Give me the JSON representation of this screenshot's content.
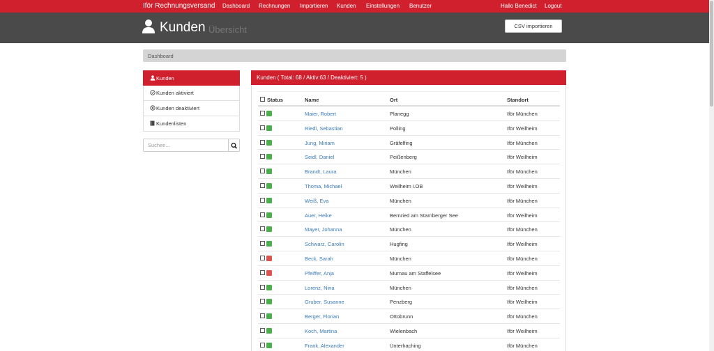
{
  "navbar": {
    "brand": "Iför Rechnungsversand",
    "items": [
      "Dashboard",
      "Rechnungen",
      "Importieren",
      "Kunden",
      "Einstellungen",
      "Benutzer"
    ],
    "greeting": "Hallo Benedict",
    "logout": "Logout"
  },
  "header": {
    "title": "Kunden",
    "subtitle": "Übersicht",
    "csv_button": "CSV importieren"
  },
  "breadcrumb": {
    "item": "Dashboard"
  },
  "sidebar": {
    "items": [
      {
        "label": "Kunden",
        "icon": "user-icon"
      },
      {
        "label": "Kunden aktiviert",
        "icon": "check-circle-icon"
      },
      {
        "label": "Kunden deaktiviert",
        "icon": "x-circle-icon"
      },
      {
        "label": "Kundenlisten",
        "icon": "book-icon"
      }
    ],
    "search_placeholder": "Suchen..."
  },
  "panel": {
    "heading": "Kunden ( Total: 68 / Aktiv:63 / Deaktiviert: 5 )",
    "columns": {
      "status": "Status",
      "name": "Name",
      "ort": "Ort",
      "standort": "Standort"
    },
    "rows": [
      {
        "status": "active",
        "name": "Maier, Robert",
        "ort": "Planegg",
        "standort": "Iför München"
      },
      {
        "status": "active",
        "name": "Riedl, Sebastian",
        "ort": "Polling",
        "standort": "Iför Weilheim"
      },
      {
        "status": "active",
        "name": "Jung, Miriam",
        "ort": "Gräfelfing",
        "standort": "Iför München"
      },
      {
        "status": "active",
        "name": "Seidl, Daniel",
        "ort": "Peißenberg",
        "standort": "Iför Weilheim"
      },
      {
        "status": "active",
        "name": "Brandt, Laura",
        "ort": "München",
        "standort": "Iför München"
      },
      {
        "status": "active",
        "name": "Thoma, Michael",
        "ort": "Weilheim i.OB",
        "standort": "Iför Weilheim"
      },
      {
        "status": "active",
        "name": "Weiß, Eva",
        "ort": "München",
        "standort": "Iför München"
      },
      {
        "status": "active",
        "name": "Auer, Heike",
        "ort": "Bernried am Starnberger See",
        "standort": "Iför Weilheim"
      },
      {
        "status": "active",
        "name": "Mayer, Johanna",
        "ort": "München",
        "standort": "Iför München"
      },
      {
        "status": "active",
        "name": "Schwarz, Carolin",
        "ort": "Hugfing",
        "standort": "Iför Weilheim"
      },
      {
        "status": "inactive",
        "name": "Beck, Sarah",
        "ort": "München",
        "standort": "Iför München"
      },
      {
        "status": "inactive",
        "name": "Pfeiffer, Anja",
        "ort": "Murnau am Staffelsee",
        "standort": "Iför Weilheim"
      },
      {
        "status": "active",
        "name": "Lorenz, Nina",
        "ort": "München",
        "standort": "Iför München"
      },
      {
        "status": "active",
        "name": "Gruber, Susanne",
        "ort": "Penzberg",
        "standort": "Iför Weilheim"
      },
      {
        "status": "active",
        "name": "Berger, Florian",
        "ort": "Ottobrunn",
        "standort": "Iför München"
      },
      {
        "status": "active",
        "name": "Koch, Martina",
        "ort": "Wielenbach",
        "standort": "Iför Weilheim"
      },
      {
        "status": "active",
        "name": "Frank, Alexander",
        "ort": "Unterhaching",
        "standort": "Iför München"
      }
    ]
  },
  "colors": {
    "brand_red": "#d0202e",
    "header_gray": "#4a4a4a",
    "active_green": "#4cae4c",
    "inactive_red": "#d9534f",
    "link_blue": "#3a7ab8"
  }
}
